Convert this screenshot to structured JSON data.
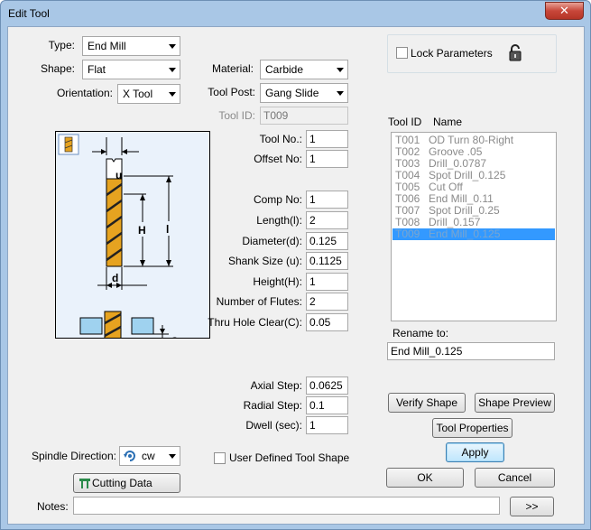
{
  "window": {
    "title": "Edit Tool",
    "close_glyph": "✕"
  },
  "left": {
    "type": {
      "label": "Type:",
      "value": "End Mill"
    },
    "shape": {
      "label": "Shape:",
      "value": "Flat"
    },
    "orientation": {
      "label": "Orientation:",
      "value": "X Tool"
    },
    "spindle": {
      "label": "Spindle Direction:",
      "value": "cw"
    },
    "cutting_data_label": "Cutting Data",
    "diagram_labels": {
      "u": "u",
      "H": "H",
      "l": "l",
      "d": "d",
      "C": "C"
    }
  },
  "middle": {
    "material": {
      "label": "Material:",
      "value": "Carbide"
    },
    "tool_post": {
      "label": "Tool Post:",
      "value": "Gang Slide"
    },
    "tool_id": {
      "label": "Tool ID:",
      "value": "T009"
    },
    "fields": [
      {
        "label": "Tool No.:",
        "value": "1"
      },
      {
        "label": "Offset No:",
        "value": "1"
      },
      {
        "label": "Comp No:",
        "value": "1"
      },
      {
        "label": "Length(l):",
        "value": "2"
      },
      {
        "label": "Diameter(d):",
        "value": "0.125"
      },
      {
        "label": "Shank Size (u):",
        "value": "0.1125"
      },
      {
        "label": "Height(H):",
        "value": "1"
      },
      {
        "label": "Number of Flutes:",
        "value": "2"
      },
      {
        "label": "Thru Hole Clear(C):",
        "value": "0.05"
      },
      {
        "label": "Axial Step:",
        "value": "0.0625"
      },
      {
        "label": "Radial Step:",
        "value": "0.1"
      },
      {
        "label": "Dwell (sec):",
        "value": "1"
      }
    ],
    "user_defined_shape_label": "User Defined Tool Shape"
  },
  "right": {
    "lock_parameters_label": "Lock Parameters",
    "list_headers": {
      "id": "Tool ID",
      "name": "Name"
    },
    "tools": [
      {
        "id": "T001",
        "name": "OD Turn 80-Right"
      },
      {
        "id": "T002",
        "name": "Groove .05"
      },
      {
        "id": "T003",
        "name": "Drill_0.0787"
      },
      {
        "id": "T004",
        "name": "Spot Drill_0.125"
      },
      {
        "id": "T005",
        "name": "Cut Off"
      },
      {
        "id": "T006",
        "name": "End Mill_0.11"
      },
      {
        "id": "T007",
        "name": "Spot Drill_0.25"
      },
      {
        "id": "T008",
        "name": "Drill_0.157"
      },
      {
        "id": "T009",
        "name": "End Mill_0.125"
      }
    ],
    "selected_tool_index": 8,
    "rename_label": "Rename to:",
    "rename_value": "End Mill_0.125",
    "buttons": {
      "verify_shape": "Verify Shape",
      "shape_preview": "Shape Preview",
      "tool_properties": "Tool Properties",
      "apply": "Apply",
      "ok": "OK",
      "cancel": "Cancel",
      "expand": ">>"
    }
  },
  "notes": {
    "label": "Notes:",
    "value": ""
  },
  "colors": {
    "selection": "#3399ff",
    "tool_gold": "#e6a320",
    "diagram_bg": "#eaf2fb",
    "frame": "#a9c7e6"
  },
  "icons": [
    "close-icon",
    "dropdown-arrow-icon",
    "padlock-icon",
    "spindle-rotation-icon",
    "cutting-data-icon",
    "flat-end-mill-icon"
  ]
}
